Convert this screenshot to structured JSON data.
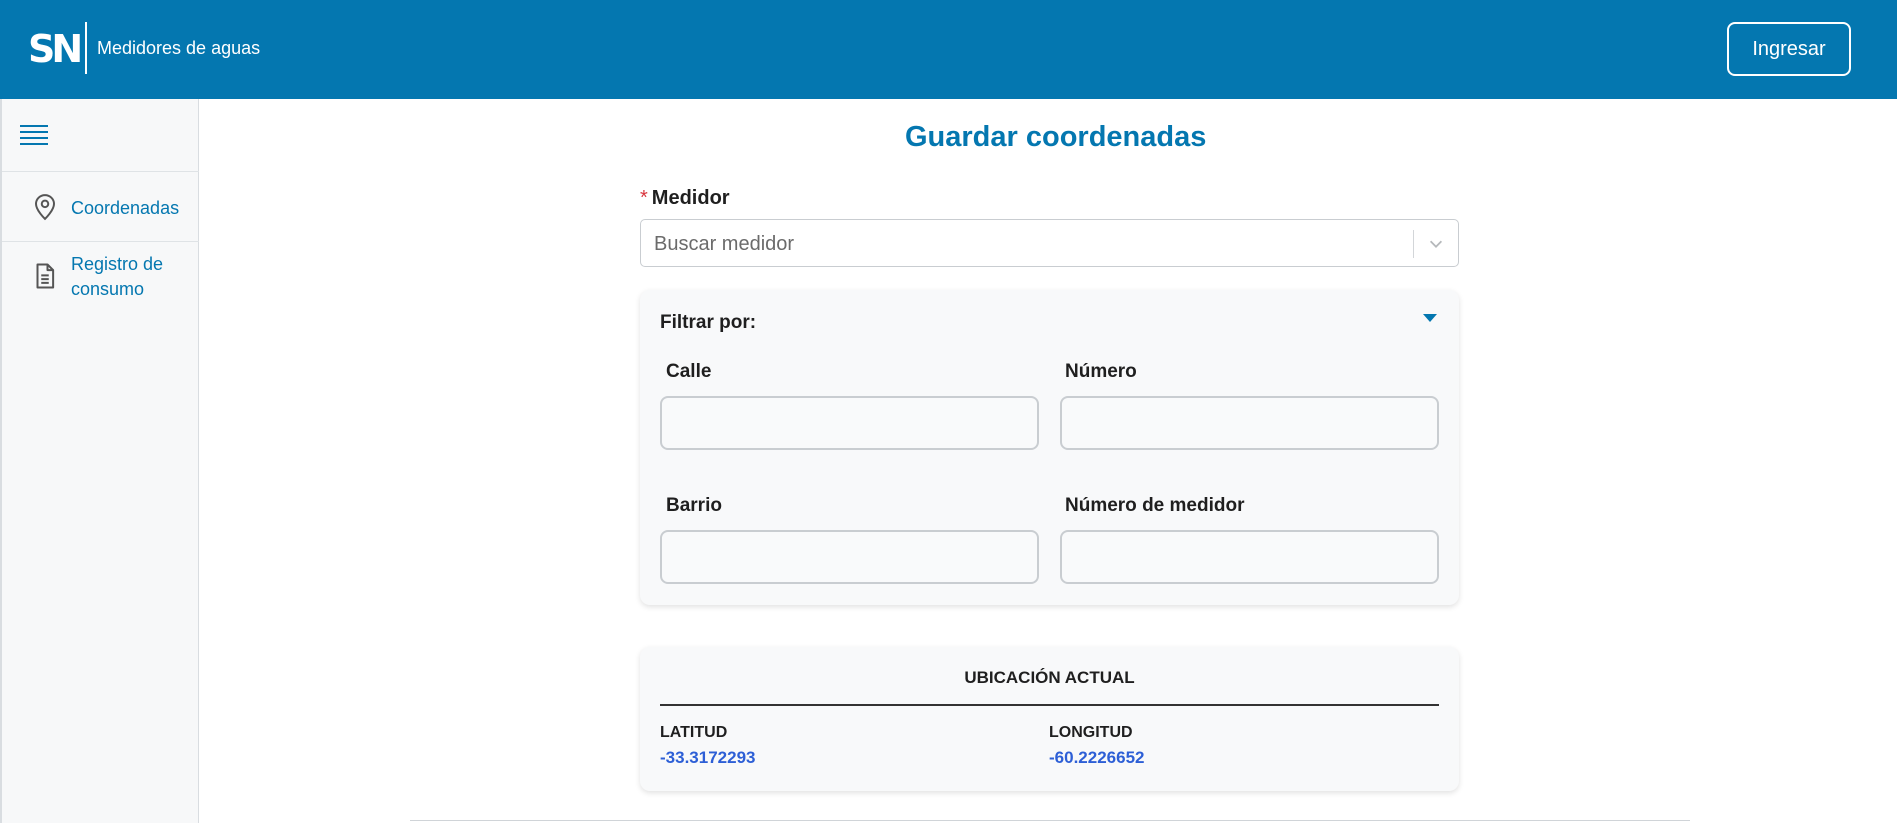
{
  "header": {
    "logo_text": "SN",
    "app_title": "Medidores de aguas",
    "login_label": "Ingresar"
  },
  "sidebar": {
    "items": [
      {
        "label": "Coordenadas",
        "icon": "location-pin-icon"
      },
      {
        "label": "Registro de consumo",
        "icon": "document-icon"
      }
    ]
  },
  "main": {
    "title": "Guardar coordenadas",
    "medidor": {
      "required_mark": "*",
      "label": "Medidor",
      "placeholder": "Buscar medidor"
    },
    "filter": {
      "title": "Filtrar por:",
      "fields": {
        "calle": "Calle",
        "numero": "Número",
        "barrio": "Barrio",
        "numero_medidor": "Número de medidor"
      }
    },
    "location": {
      "title": "UBICACIÓN ACTUAL",
      "lat_label": "LATITUD",
      "lat_value": "-33.3172293",
      "lng_label": "LONGITUD",
      "lng_value": "-60.2226652"
    }
  },
  "colors": {
    "primary": "#0477b0",
    "coordinate_value": "#2d5fd6",
    "required": "#d9363e"
  }
}
